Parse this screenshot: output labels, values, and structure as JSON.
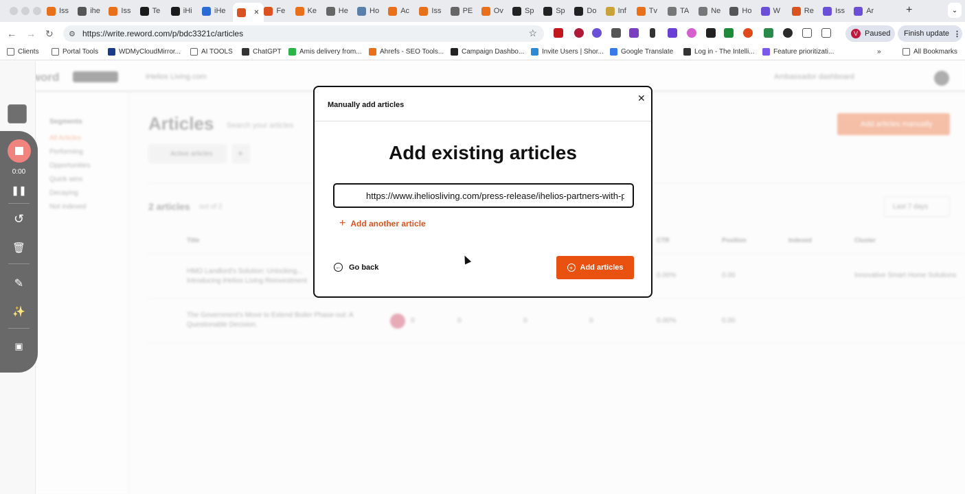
{
  "browser": {
    "tabs": [
      {
        "label": "Iss",
        "color": "#e8701a"
      },
      {
        "label": "ihe",
        "color": "#555555"
      },
      {
        "label": "Iss",
        "color": "#e8701a"
      },
      {
        "label": "Te",
        "color": "#1a1a1a"
      },
      {
        "label": "iHi",
        "color": "#1a1a1a"
      },
      {
        "label": "iHe",
        "color": "#2a6bd6"
      },
      {
        "label": "",
        "color": "#d9531e"
      },
      {
        "label": "Fe",
        "color": "#d9531e"
      },
      {
        "label": "Ke",
        "color": "#e8701a"
      },
      {
        "label": "He",
        "color": "#666666"
      },
      {
        "label": "Ho",
        "color": "#5a7fa8"
      },
      {
        "label": "Ac",
        "color": "#e8701a"
      },
      {
        "label": "Iss",
        "color": "#e8701a"
      },
      {
        "label": "PE",
        "color": "#666666"
      },
      {
        "label": "Ov",
        "color": "#e8701a"
      },
      {
        "label": "Sp",
        "color": "#222222"
      },
      {
        "label": "Sp",
        "color": "#222222"
      },
      {
        "label": "Do",
        "color": "#222222"
      },
      {
        "label": "Inf",
        "color": "#c9a23a"
      },
      {
        "label": "Tv",
        "color": "#e8701a"
      },
      {
        "label": "TA",
        "color": "#777777"
      },
      {
        "label": "Ne",
        "color": "#777777"
      },
      {
        "label": "Ho",
        "color": "#555555"
      },
      {
        "label": "W",
        "color": "#6b4fd6"
      },
      {
        "label": "Re",
        "color": "#d9531e"
      },
      {
        "label": "Iss",
        "color": "#6b4fd6"
      },
      {
        "label": "Ar",
        "color": "#6b4fd6"
      }
    ],
    "url": "https://write.reword.com/p/bdc3321c/articles",
    "profile_status": "Paused",
    "profile_initial": "V",
    "update_button": "Finish update",
    "bookmarks": [
      {
        "label": "Clients",
        "icon": "folder-icon"
      },
      {
        "label": "Portal Tools",
        "icon": "folder-icon"
      },
      {
        "label": "WDMyCloudMirror...",
        "icon": "wd-icon"
      },
      {
        "label": "AI TOOLS",
        "icon": "folder-icon"
      },
      {
        "label": "ChatGPT",
        "icon": "chatgpt-icon"
      },
      {
        "label": "Amis delivery from...",
        "icon": "amis-icon"
      },
      {
        "label": "Ahrefs - SEO Tools...",
        "icon": "ahrefs-icon"
      },
      {
        "label": "Campaign Dashbo...",
        "icon": "campaign-icon"
      },
      {
        "label": "Invite Users | Shor...",
        "icon": "shortcut-icon"
      },
      {
        "label": "Google Translate",
        "icon": "translate-icon"
      },
      {
        "label": "Log in - The Intelli...",
        "icon": "t-icon"
      },
      {
        "label": "Feature prioritizati...",
        "icon": "feature-icon"
      }
    ],
    "all_bookmarks": "All Bookmarks"
  },
  "app": {
    "logo": "Reword",
    "site_selector": "iHelios Living.com",
    "ambassador": "Ambassador dashboard",
    "page_title": "Articles",
    "search_placeholder": "Search your articles",
    "segments_heading": "Segments",
    "segments": [
      "All Articles",
      "Performing",
      "Opportunities",
      "Quick wins",
      "Decaying",
      "Not indexed"
    ],
    "active_filter": "Active articles",
    "add_manually": "Add articles manually",
    "count": "2 articles",
    "count_suffix": "out of 2",
    "date_range": "Last 7 days",
    "columns": [
      "Title",
      "CTR",
      "Position",
      "Indexed",
      "Cluster"
    ],
    "rows": [
      {
        "title": "HMO Landlord's Solution: Unlocking... Introducing iHelios Living Reinvestment",
        "ctr": "0.00%",
        "position": "0.00",
        "cluster": "Innovative Smart Home Solutions"
      },
      {
        "title": "The Government's Move to Extend Boiler Phase-out: A Questionable Decision.",
        "c1": "0",
        "c2": "0",
        "c3": "0",
        "c4": "0",
        "c5": "0",
        "ctr": "0.00%",
        "position": "0.00"
      }
    ]
  },
  "recorder": {
    "timer": "0:00"
  },
  "modal": {
    "title": "Manually add articles",
    "heading": "Add existing articles",
    "url_value": "https://www.iheliosliving.com/press-release/ihelios-partners-with-p",
    "add_another": "Add another article",
    "go_back": "Go back",
    "submit": "Add articles"
  }
}
